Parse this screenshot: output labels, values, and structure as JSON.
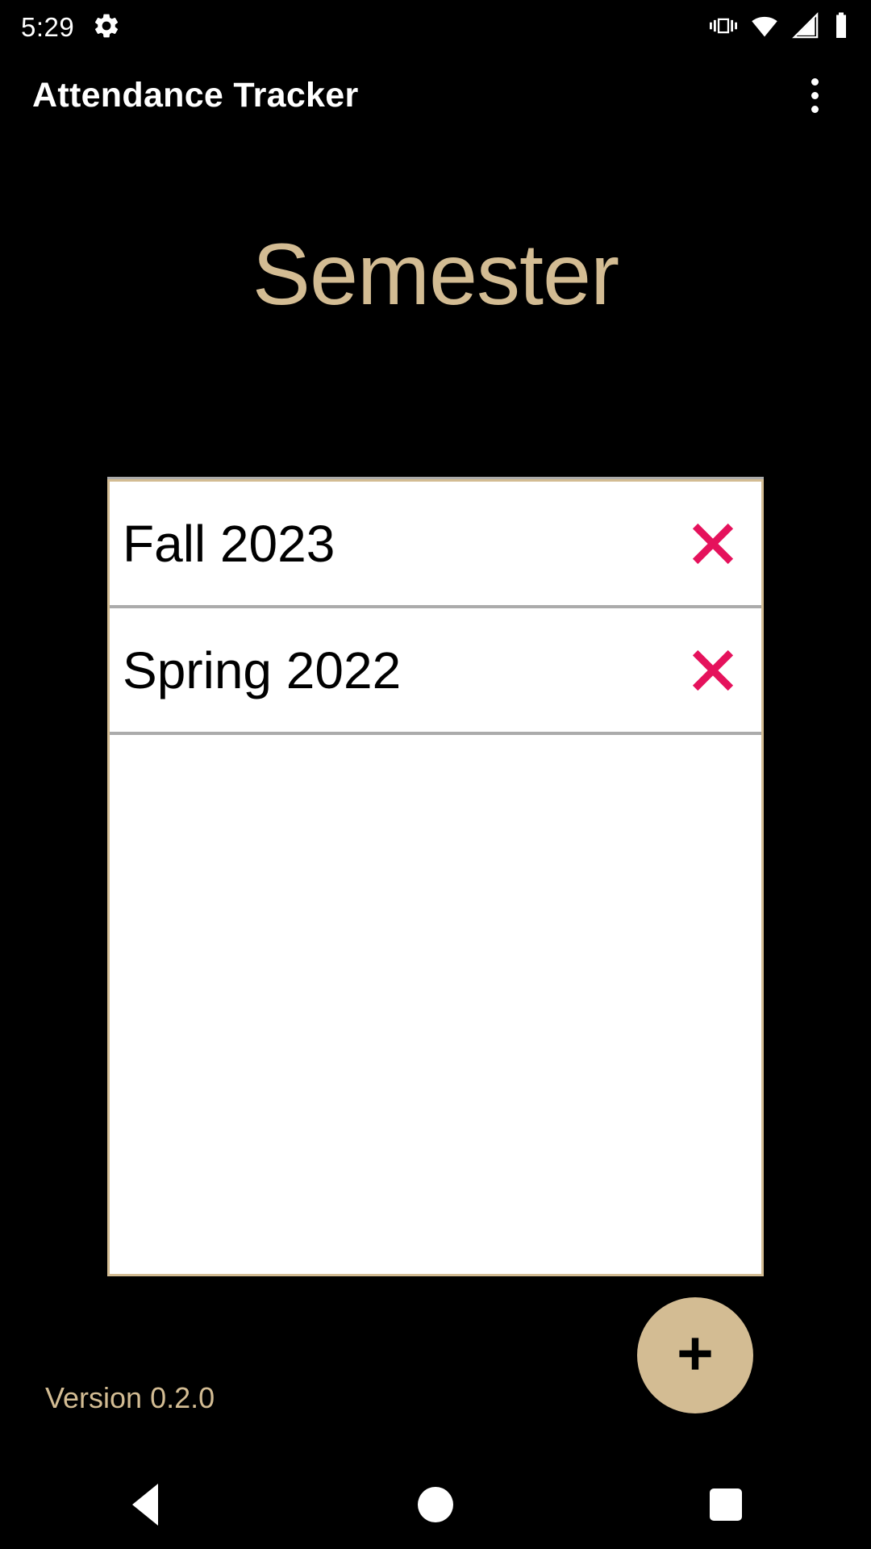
{
  "status_bar": {
    "clock": "5:29",
    "left_icons": [
      {
        "name": "settings-gear-icon",
        "glyph": "gear"
      }
    ],
    "right_icons": [
      {
        "name": "vibrate-mode-icon",
        "glyph": "vibrate"
      },
      {
        "name": "wifi-icon",
        "glyph": "wifi"
      },
      {
        "name": "cellular-signal-icon",
        "glyph": "signal"
      },
      {
        "name": "battery-icon",
        "glyph": "battery"
      }
    ]
  },
  "app_bar": {
    "title": "Attendance Tracker",
    "overflow_menu_icon": "more-vertical-icon"
  },
  "main": {
    "screen_title": "Semester",
    "semesters": [
      {
        "name": "Fall 2023",
        "delete_icon": "x-close-icon"
      },
      {
        "name": "Spring 2022",
        "delete_icon": "x-close-icon"
      }
    ],
    "add_button": {
      "icon": "plus-icon",
      "label": "+"
    },
    "version_text": "Version 0.2.0"
  },
  "navigation_bar": {
    "back_label": "Back",
    "home_label": "Home",
    "recents_label": "Recents"
  },
  "colors": {
    "background": "#000000",
    "accent_tan": "#d3bc93",
    "card_background": "#ffffff",
    "row_text": "#000000",
    "divider": "#ababab",
    "delete_x": "#e5125c",
    "on_background": "#ffffff"
  }
}
